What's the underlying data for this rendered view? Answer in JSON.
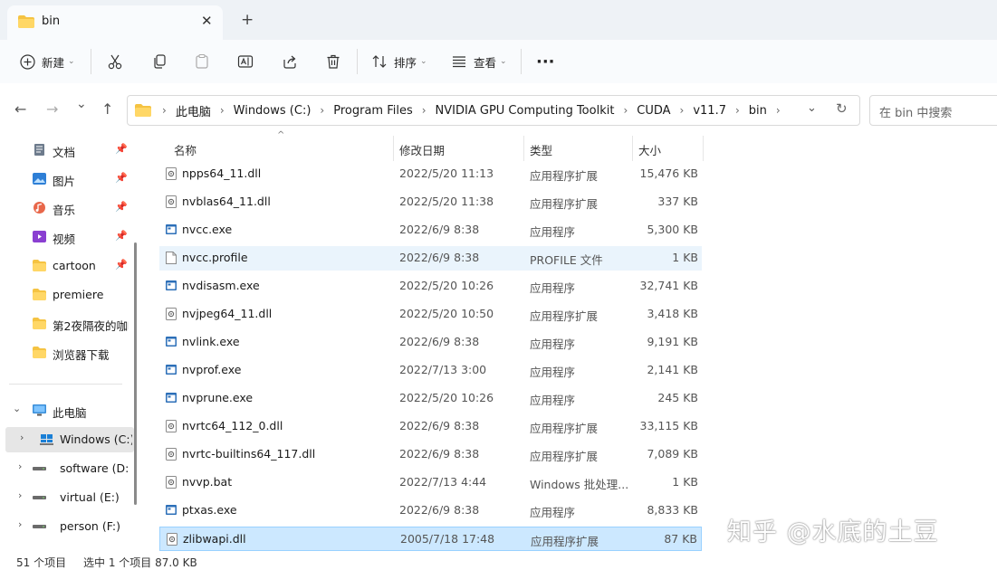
{
  "tab": {
    "title": "bin",
    "close": "✕",
    "new_tab": "+"
  },
  "toolbar": {
    "new_label": "新建",
    "sort_label": "排序",
    "view_label": "查看",
    "more": "···"
  },
  "nav": {
    "back": "←",
    "forward": "→",
    "recent": "⌄",
    "up": "↑"
  },
  "breadcrumbs": [
    "此电脑",
    "Windows (C:)",
    "Program Files",
    "NVIDIA GPU Computing Toolkit",
    "CUDA",
    "v11.7",
    "bin"
  ],
  "search": {
    "placeholder": "在 bin 中搜索"
  },
  "sidebar": {
    "quick": [
      {
        "label": "文档",
        "icon": "document-icon",
        "pinned": true
      },
      {
        "label": "图片",
        "icon": "pictures-icon",
        "pinned": true
      },
      {
        "label": "音乐",
        "icon": "music-icon",
        "pinned": true
      },
      {
        "label": "视频",
        "icon": "videos-icon",
        "pinned": true
      },
      {
        "label": "cartoon",
        "icon": "folder-icon",
        "pinned": true
      },
      {
        "label": "premiere",
        "icon": "folder-icon",
        "pinned": false
      },
      {
        "label": "第2夜隔夜的咖啡",
        "icon": "folder-icon",
        "pinned": false
      },
      {
        "label": "浏览器下载",
        "icon": "folder-icon",
        "pinned": false
      }
    ],
    "this_pc": "此电脑",
    "drives": [
      {
        "label": "Windows (C:)",
        "selected": true
      },
      {
        "label": "software (D:)",
        "selected": false
      },
      {
        "label": "virtual (E:)",
        "selected": false
      },
      {
        "label": "person (F:)",
        "selected": false
      }
    ]
  },
  "columns": {
    "name": "名称",
    "date": "修改日期",
    "type": "类型",
    "size": "大小"
  },
  "files": [
    {
      "name": "npps64_11.dll",
      "date": "2022/5/20 11:13",
      "type": "应用程序扩展",
      "size": "15,476 KB",
      "kind": "dll"
    },
    {
      "name": "nvblas64_11.dll",
      "date": "2022/5/20 11:38",
      "type": "应用程序扩展",
      "size": "337 KB",
      "kind": "dll"
    },
    {
      "name": "nvcc.exe",
      "date": "2022/6/9 8:38",
      "type": "应用程序",
      "size": "5,300 KB",
      "kind": "exe"
    },
    {
      "name": "nvcc.profile",
      "date": "2022/6/9 8:38",
      "type": "PROFILE 文件",
      "size": "1 KB",
      "kind": "file",
      "state": "hover"
    },
    {
      "name": "nvdisasm.exe",
      "date": "2022/5/20 10:26",
      "type": "应用程序",
      "size": "32,741 KB",
      "kind": "exe"
    },
    {
      "name": "nvjpeg64_11.dll",
      "date": "2022/5/20 10:50",
      "type": "应用程序扩展",
      "size": "3,418 KB",
      "kind": "dll"
    },
    {
      "name": "nvlink.exe",
      "date": "2022/6/9 8:38",
      "type": "应用程序",
      "size": "9,191 KB",
      "kind": "exe"
    },
    {
      "name": "nvprof.exe",
      "date": "2022/7/13 3:00",
      "type": "应用程序",
      "size": "2,141 KB",
      "kind": "exe"
    },
    {
      "name": "nvprune.exe",
      "date": "2022/5/20 10:26",
      "type": "应用程序",
      "size": "245 KB",
      "kind": "exe"
    },
    {
      "name": "nvrtc64_112_0.dll",
      "date": "2022/6/9 8:38",
      "type": "应用程序扩展",
      "size": "33,115 KB",
      "kind": "dll"
    },
    {
      "name": "nvrtc-builtins64_117.dll",
      "date": "2022/6/9 8:38",
      "type": "应用程序扩展",
      "size": "7,089 KB",
      "kind": "dll"
    },
    {
      "name": "nvvp.bat",
      "date": "2022/7/13 4:44",
      "type": "Windows 批处理...",
      "size": "1 KB",
      "kind": "bat"
    },
    {
      "name": "ptxas.exe",
      "date": "2022/6/9 8:38",
      "type": "应用程序",
      "size": "8,833 KB",
      "kind": "exe"
    },
    {
      "name": "zlibwapi.dll",
      "date": "2005/7/18 17:48",
      "type": "应用程序扩展",
      "size": "87 KB",
      "kind": "dll",
      "state": "selected"
    }
  ],
  "status": {
    "count": "51 个项目",
    "selected": "选中 1 个项目 87.0 KB"
  },
  "watermark": "知乎 @水底的土豆",
  "colors": {
    "selection": "#cce8ff",
    "hover": "#eaf4fc",
    "folder": "#f5c342",
    "accent": "#0067c0"
  }
}
